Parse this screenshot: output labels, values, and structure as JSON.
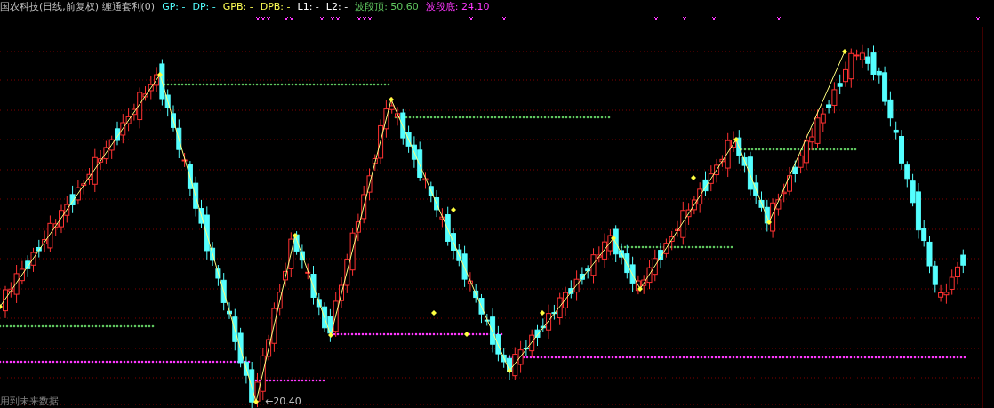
{
  "header": {
    "title": "国农科技(日线,前复权) 缠通套利(0)",
    "indicators": [
      {
        "label": "GP: -",
        "color": "#54ffff"
      },
      {
        "label": "DP: -",
        "color": "#54ffff"
      },
      {
        "label": "GPB: -",
        "color": "#ffff54"
      },
      {
        "label": "DPB: -",
        "color": "#ffff54"
      },
      {
        "label": "L1: -",
        "color": "#ffffff"
      },
      {
        "label": "L2: -",
        "color": "#ffffff"
      },
      {
        "label": "波段顶: 50.60",
        "color": "#5fc65f"
      },
      {
        "label": "波段底: 24.10",
        "color": "#ff38ff"
      }
    ]
  },
  "chart": {
    "low_label": "←20.40"
  },
  "footer": {
    "note": "用到未来数据"
  }
}
